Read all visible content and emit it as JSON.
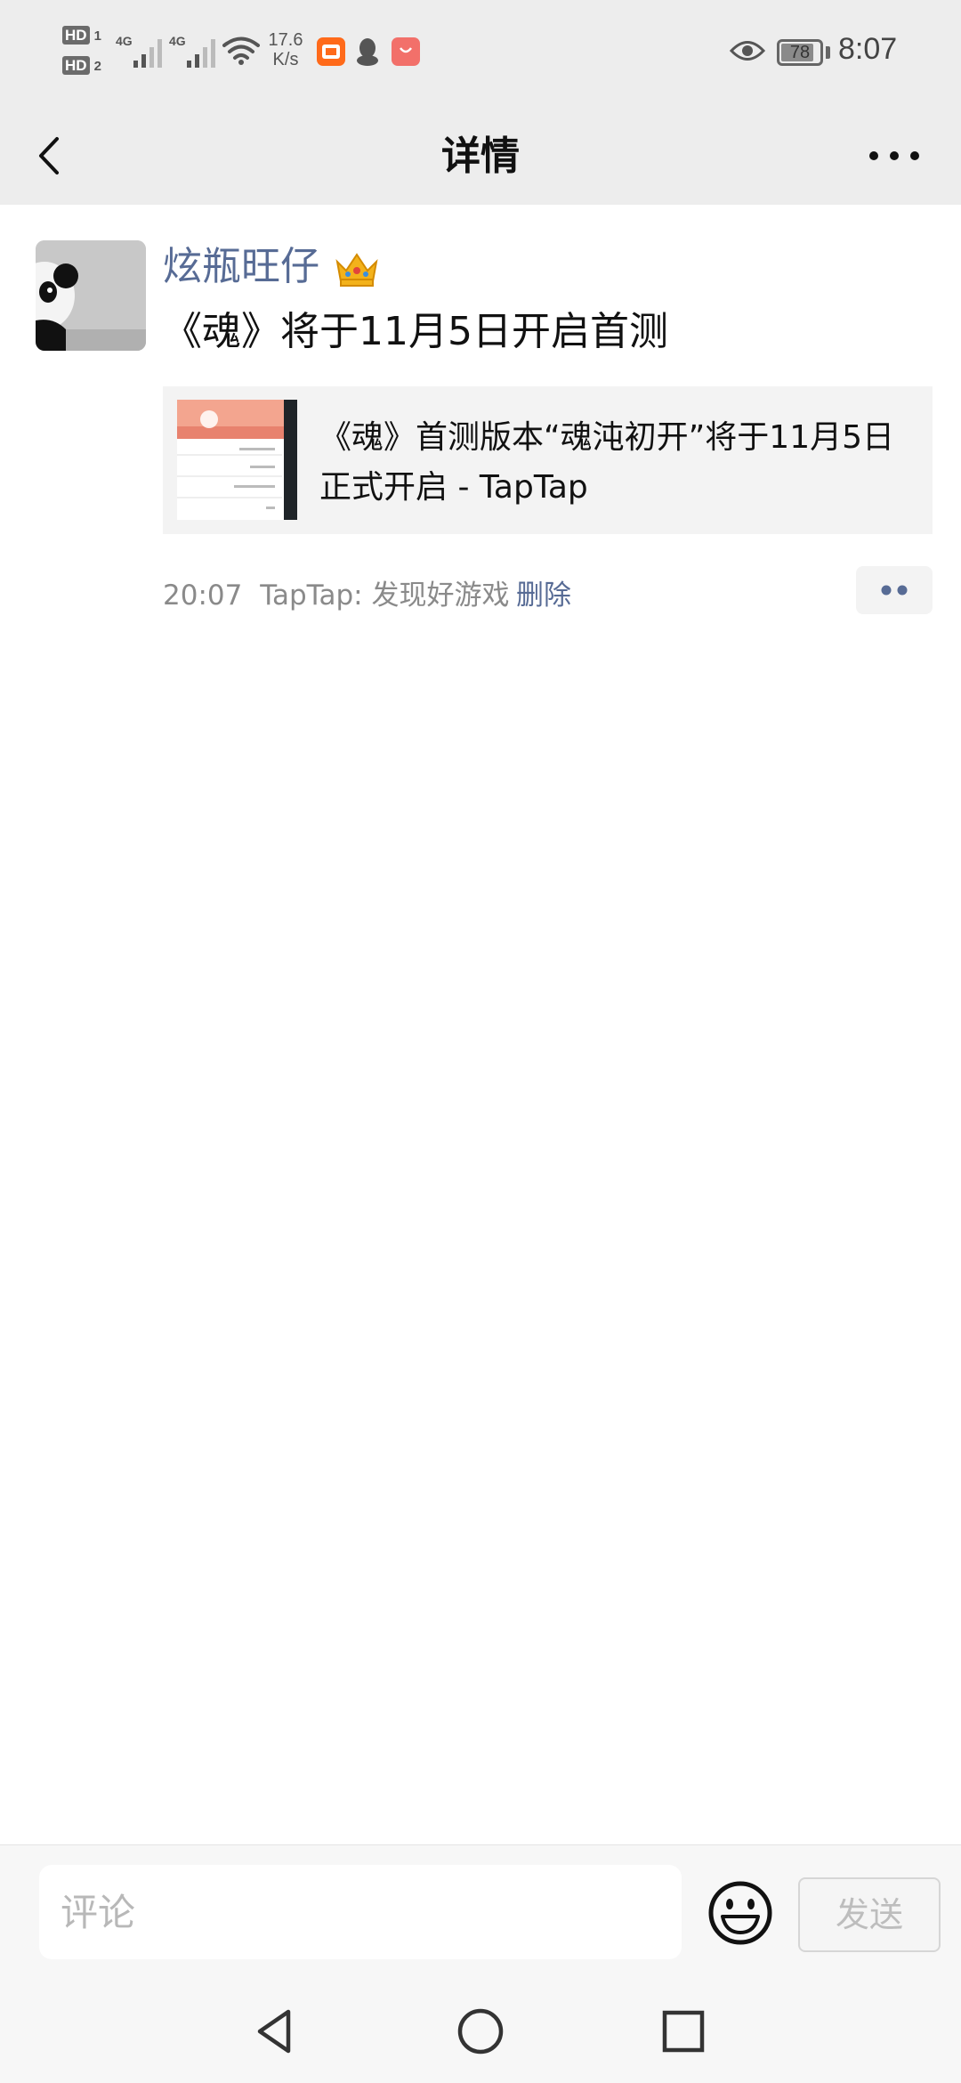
{
  "status_bar": {
    "sim1": "HD",
    "sim1_num": "1",
    "sim2": "HD",
    "sim2_num": "2",
    "net1": "4G",
    "net2": "4G",
    "speed_value": "17.6",
    "speed_unit": "K/s",
    "battery_level": "78",
    "time": "8:07",
    "icons": [
      "signal-icon",
      "wifi-icon",
      "taobao-app-icon",
      "qq-icon",
      "shopping-bag-icon",
      "eye-icon",
      "battery-icon"
    ]
  },
  "header": {
    "title": "详情",
    "back_icon": "back-arrow-icon",
    "more_icon": "more-horizontal-icon"
  },
  "post": {
    "author": "炫瓶旺仔",
    "author_badge": "crown-icon",
    "text": "《魂》将于11月5日开启首测",
    "link": {
      "title": "《魂》首测版本“魂沌初开”将于11月5日正式开启 - TapTap"
    },
    "time": "20:07",
    "source": "TapTap: 发现好游戏",
    "delete_label": "删除"
  },
  "comment_bar": {
    "placeholder": "评论",
    "send_label": "发送",
    "emoji_icon": "smiley-face-icon"
  },
  "nav_bar": {
    "icons": [
      "nav-back-triangle-icon",
      "nav-home-circle-icon",
      "nav-recents-square-icon"
    ]
  },
  "colors": {
    "header_bg": "#ededed",
    "link_blue": "#576b95",
    "card_bg": "#f3f3f3"
  }
}
